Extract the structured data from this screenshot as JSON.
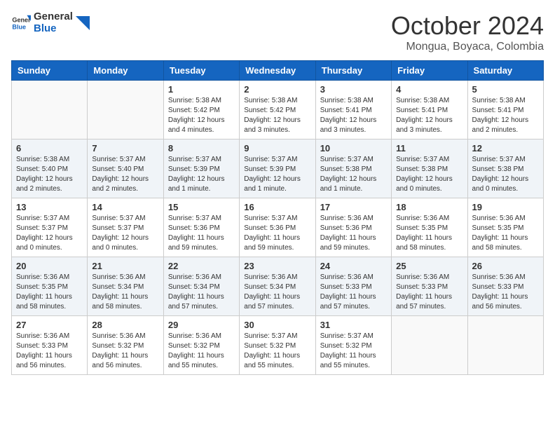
{
  "header": {
    "logo_general": "General",
    "logo_blue": "Blue",
    "month": "October 2024",
    "location": "Mongua, Boyaca, Colombia"
  },
  "weekdays": [
    "Sunday",
    "Monday",
    "Tuesday",
    "Wednesday",
    "Thursday",
    "Friday",
    "Saturday"
  ],
  "weeks": [
    [
      {
        "day": "",
        "sunrise": "",
        "sunset": "",
        "daylight": ""
      },
      {
        "day": "",
        "sunrise": "",
        "sunset": "",
        "daylight": ""
      },
      {
        "day": "1",
        "sunrise": "Sunrise: 5:38 AM",
        "sunset": "Sunset: 5:42 PM",
        "daylight": "Daylight: 12 hours and 4 minutes."
      },
      {
        "day": "2",
        "sunrise": "Sunrise: 5:38 AM",
        "sunset": "Sunset: 5:42 PM",
        "daylight": "Daylight: 12 hours and 3 minutes."
      },
      {
        "day": "3",
        "sunrise": "Sunrise: 5:38 AM",
        "sunset": "Sunset: 5:41 PM",
        "daylight": "Daylight: 12 hours and 3 minutes."
      },
      {
        "day": "4",
        "sunrise": "Sunrise: 5:38 AM",
        "sunset": "Sunset: 5:41 PM",
        "daylight": "Daylight: 12 hours and 3 minutes."
      },
      {
        "day": "5",
        "sunrise": "Sunrise: 5:38 AM",
        "sunset": "Sunset: 5:41 PM",
        "daylight": "Daylight: 12 hours and 2 minutes."
      }
    ],
    [
      {
        "day": "6",
        "sunrise": "Sunrise: 5:38 AM",
        "sunset": "Sunset: 5:40 PM",
        "daylight": "Daylight: 12 hours and 2 minutes."
      },
      {
        "day": "7",
        "sunrise": "Sunrise: 5:37 AM",
        "sunset": "Sunset: 5:40 PM",
        "daylight": "Daylight: 12 hours and 2 minutes."
      },
      {
        "day": "8",
        "sunrise": "Sunrise: 5:37 AM",
        "sunset": "Sunset: 5:39 PM",
        "daylight": "Daylight: 12 hours and 1 minute."
      },
      {
        "day": "9",
        "sunrise": "Sunrise: 5:37 AM",
        "sunset": "Sunset: 5:39 PM",
        "daylight": "Daylight: 12 hours and 1 minute."
      },
      {
        "day": "10",
        "sunrise": "Sunrise: 5:37 AM",
        "sunset": "Sunset: 5:38 PM",
        "daylight": "Daylight: 12 hours and 1 minute."
      },
      {
        "day": "11",
        "sunrise": "Sunrise: 5:37 AM",
        "sunset": "Sunset: 5:38 PM",
        "daylight": "Daylight: 12 hours and 0 minutes."
      },
      {
        "day": "12",
        "sunrise": "Sunrise: 5:37 AM",
        "sunset": "Sunset: 5:38 PM",
        "daylight": "Daylight: 12 hours and 0 minutes."
      }
    ],
    [
      {
        "day": "13",
        "sunrise": "Sunrise: 5:37 AM",
        "sunset": "Sunset: 5:37 PM",
        "daylight": "Daylight: 12 hours and 0 minutes."
      },
      {
        "day": "14",
        "sunrise": "Sunrise: 5:37 AM",
        "sunset": "Sunset: 5:37 PM",
        "daylight": "Daylight: 12 hours and 0 minutes."
      },
      {
        "day": "15",
        "sunrise": "Sunrise: 5:37 AM",
        "sunset": "Sunset: 5:36 PM",
        "daylight": "Daylight: 11 hours and 59 minutes."
      },
      {
        "day": "16",
        "sunrise": "Sunrise: 5:37 AM",
        "sunset": "Sunset: 5:36 PM",
        "daylight": "Daylight: 11 hours and 59 minutes."
      },
      {
        "day": "17",
        "sunrise": "Sunrise: 5:36 AM",
        "sunset": "Sunset: 5:36 PM",
        "daylight": "Daylight: 11 hours and 59 minutes."
      },
      {
        "day": "18",
        "sunrise": "Sunrise: 5:36 AM",
        "sunset": "Sunset: 5:35 PM",
        "daylight": "Daylight: 11 hours and 58 minutes."
      },
      {
        "day": "19",
        "sunrise": "Sunrise: 5:36 AM",
        "sunset": "Sunset: 5:35 PM",
        "daylight": "Daylight: 11 hours and 58 minutes."
      }
    ],
    [
      {
        "day": "20",
        "sunrise": "Sunrise: 5:36 AM",
        "sunset": "Sunset: 5:35 PM",
        "daylight": "Daylight: 11 hours and 58 minutes."
      },
      {
        "day": "21",
        "sunrise": "Sunrise: 5:36 AM",
        "sunset": "Sunset: 5:34 PM",
        "daylight": "Daylight: 11 hours and 58 minutes."
      },
      {
        "day": "22",
        "sunrise": "Sunrise: 5:36 AM",
        "sunset": "Sunset: 5:34 PM",
        "daylight": "Daylight: 11 hours and 57 minutes."
      },
      {
        "day": "23",
        "sunrise": "Sunrise: 5:36 AM",
        "sunset": "Sunset: 5:34 PM",
        "daylight": "Daylight: 11 hours and 57 minutes."
      },
      {
        "day": "24",
        "sunrise": "Sunrise: 5:36 AM",
        "sunset": "Sunset: 5:33 PM",
        "daylight": "Daylight: 11 hours and 57 minutes."
      },
      {
        "day": "25",
        "sunrise": "Sunrise: 5:36 AM",
        "sunset": "Sunset: 5:33 PM",
        "daylight": "Daylight: 11 hours and 57 minutes."
      },
      {
        "day": "26",
        "sunrise": "Sunrise: 5:36 AM",
        "sunset": "Sunset: 5:33 PM",
        "daylight": "Daylight: 11 hours and 56 minutes."
      }
    ],
    [
      {
        "day": "27",
        "sunrise": "Sunrise: 5:36 AM",
        "sunset": "Sunset: 5:33 PM",
        "daylight": "Daylight: 11 hours and 56 minutes."
      },
      {
        "day": "28",
        "sunrise": "Sunrise: 5:36 AM",
        "sunset": "Sunset: 5:32 PM",
        "daylight": "Daylight: 11 hours and 56 minutes."
      },
      {
        "day": "29",
        "sunrise": "Sunrise: 5:36 AM",
        "sunset": "Sunset: 5:32 PM",
        "daylight": "Daylight: 11 hours and 55 minutes."
      },
      {
        "day": "30",
        "sunrise": "Sunrise: 5:37 AM",
        "sunset": "Sunset: 5:32 PM",
        "daylight": "Daylight: 11 hours and 55 minutes."
      },
      {
        "day": "31",
        "sunrise": "Sunrise: 5:37 AM",
        "sunset": "Sunset: 5:32 PM",
        "daylight": "Daylight: 11 hours and 55 minutes."
      },
      {
        "day": "",
        "sunrise": "",
        "sunset": "",
        "daylight": ""
      },
      {
        "day": "",
        "sunrise": "",
        "sunset": "",
        "daylight": ""
      }
    ]
  ]
}
